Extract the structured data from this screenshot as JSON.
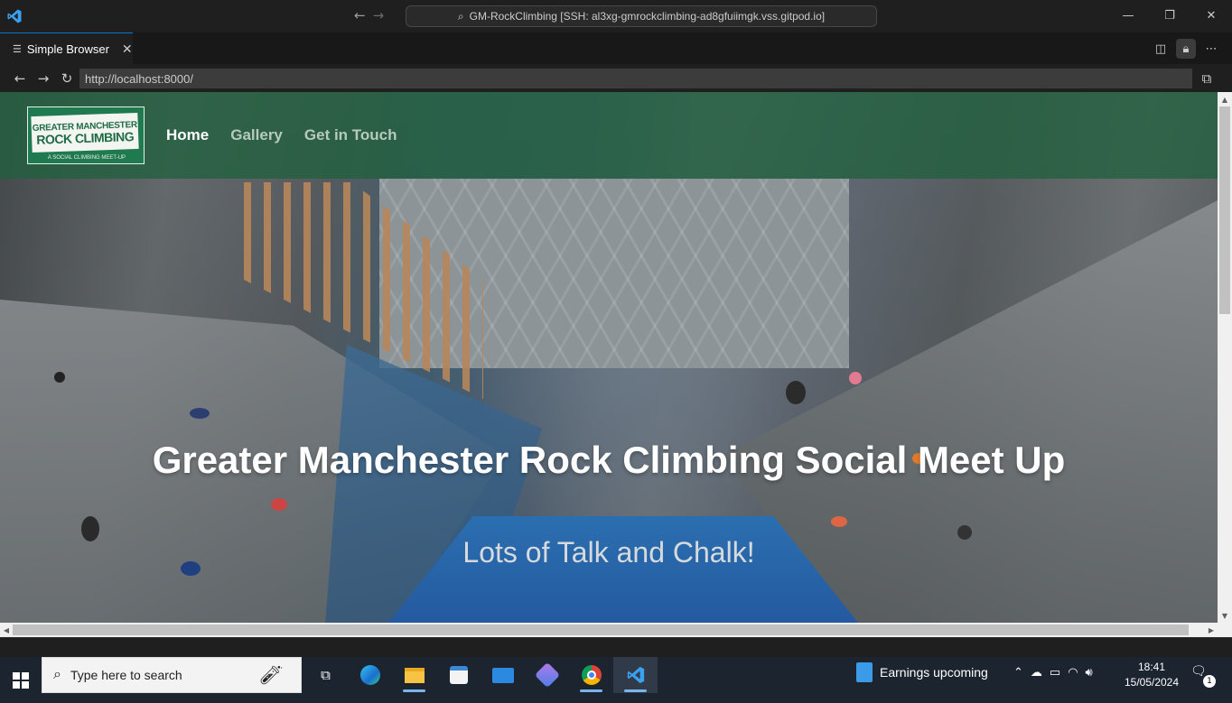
{
  "titlebar": {
    "command_center": "GM-RockClimbing [SSH: al3xg-gmrockclimbing-ad8gfuiimgk.vss.gitpod.io]"
  },
  "tabs": [
    {
      "label": "Simple Browser"
    }
  ],
  "browser": {
    "url": "http://localhost:8000/"
  },
  "page": {
    "logo": {
      "line1": "GREATER MANCHESTER",
      "line2": "ROCK CLIMBING",
      "tagline": "A SOCIAL CLIMBING MEET-UP"
    },
    "nav": [
      {
        "label": "Home",
        "active": true
      },
      {
        "label": "Gallery",
        "active": false
      },
      {
        "label": "Get in Touch",
        "active": false
      }
    ],
    "hero": {
      "title": "Greater Manchester Rock Climbing Social Meet Up",
      "subtitle": "Lots of Talk and Chalk!"
    }
  },
  "taskbar": {
    "search_placeholder": "Type here to search",
    "news_widget": "Earnings upcoming",
    "time": "18:41",
    "date": "15/05/2024",
    "notification_count": "1",
    "apps": [
      "task-view-icon",
      "edge-icon",
      "file-explorer-icon",
      "microsoft-store-icon",
      "mail-icon",
      "copilot-icon",
      "chrome-icon",
      "vscode-icon"
    ]
  },
  "colors": {
    "navbar_green": "#20603e",
    "vscode_accent": "#0078d4",
    "taskbar_bg": "#1c2430"
  }
}
